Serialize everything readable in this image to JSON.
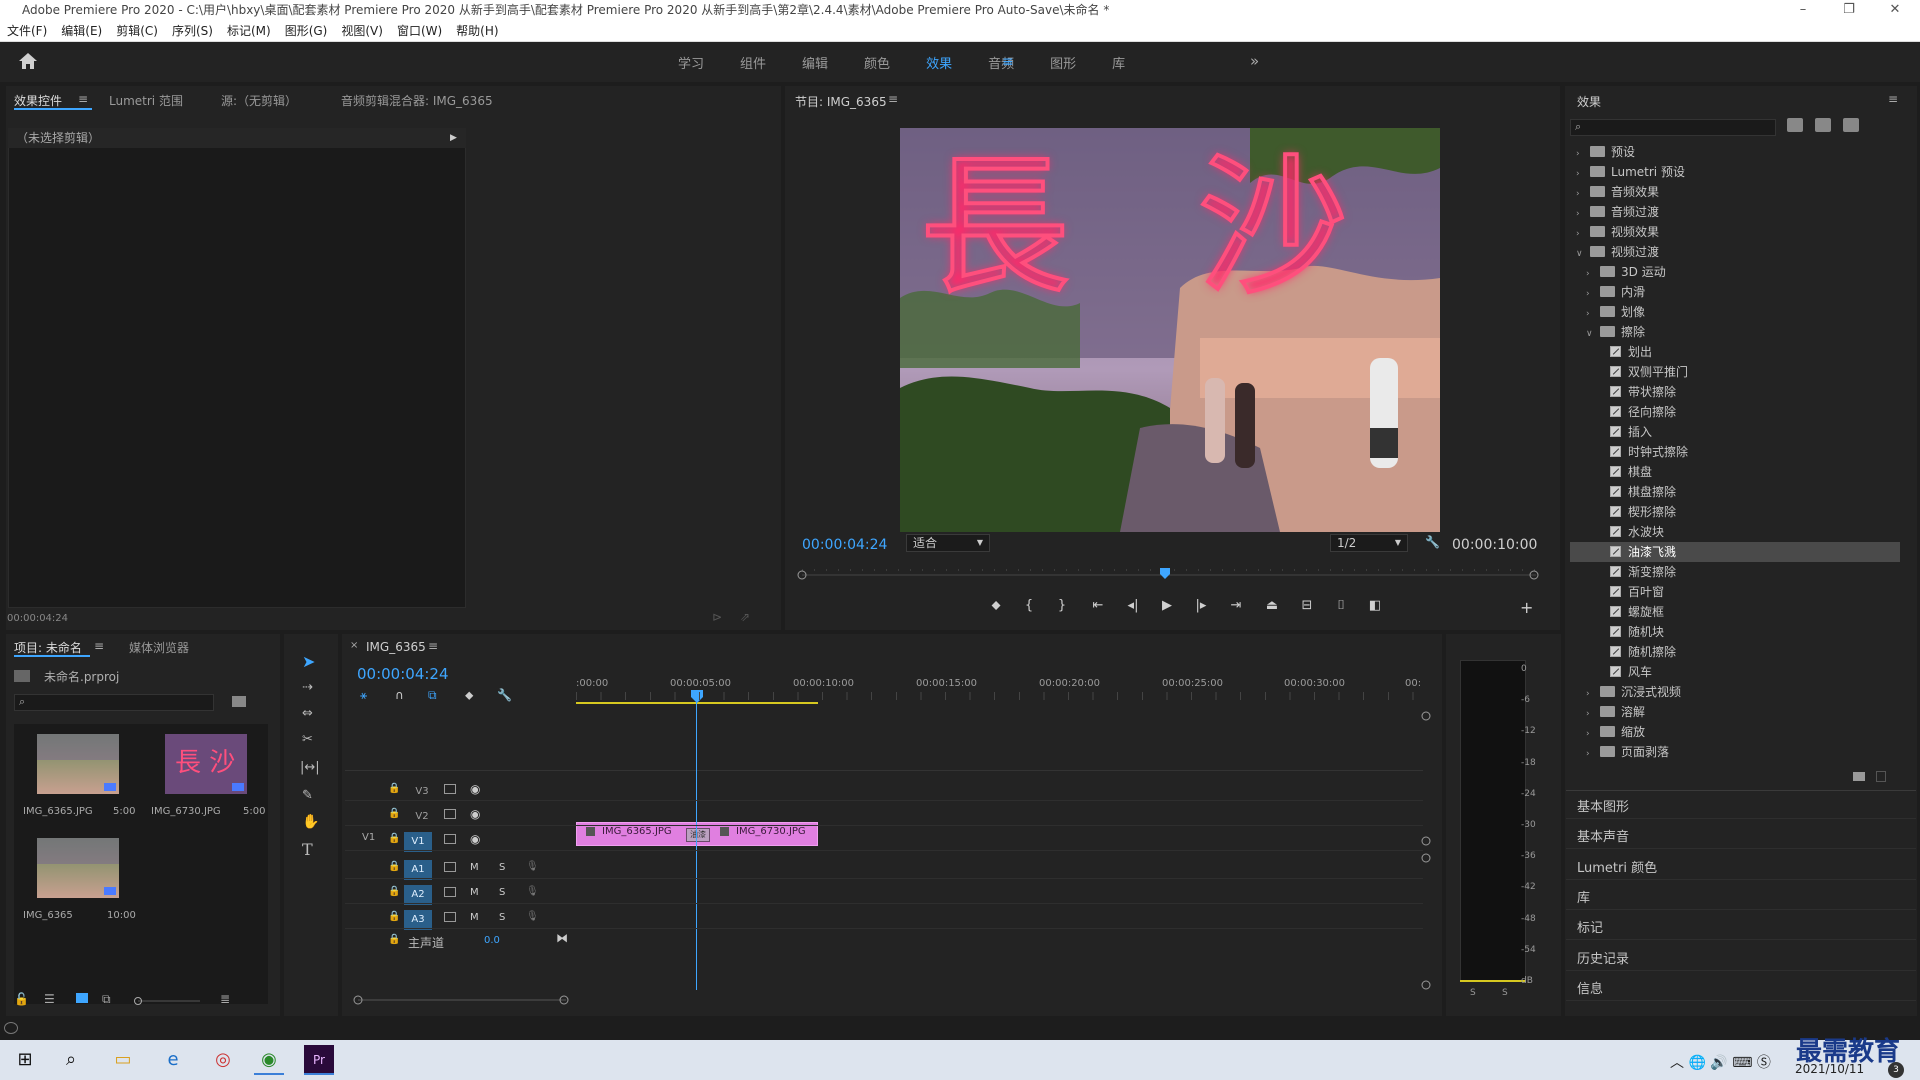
{
  "window": {
    "title": "Adobe Premiere Pro 2020 - C:\\用户\\hbxy\\桌面\\配套素材 Premiere Pro 2020 从新手到高手\\配套素材 Premiere Pro 2020 从新手到高手\\第2章\\2.4.4\\素材\\Adobe Premiere Pro Auto-Save\\未命名 *",
    "logo": "Pr"
  },
  "menu": [
    "文件(F)",
    "编辑(E)",
    "剪辑(C)",
    "序列(S)",
    "标记(M)",
    "图形(G)",
    "视图(V)",
    "窗口(W)",
    "帮助(H)"
  ],
  "workspaces": {
    "items": [
      "学习",
      "组件",
      "编辑",
      "颜色",
      "效果",
      "音频",
      "图形",
      "库"
    ],
    "active": "效果",
    "more": "»"
  },
  "source_panel": {
    "tabs": [
      "效果控件",
      "Lumetri 范围",
      "源:（无剪辑）",
      "音频剪辑混合器: IMG_6365"
    ],
    "no_clip": "（未选择剪辑）",
    "timecode": "00:00:04:24"
  },
  "program": {
    "title": "节目: IMG_6365",
    "timecode": "00:00:04:24",
    "fit": "适合",
    "res": "1/2",
    "duration": "00:00:10:00",
    "sign": "長 沙"
  },
  "project": {
    "tabs": [
      "项目: 未命名",
      "媒体浏览器"
    ],
    "file": "未命名.prproj",
    "items": [
      {
        "name": "IMG_6365.JPG",
        "dur": "5:00"
      },
      {
        "name": "IMG_6730.JPG",
        "dur": "5:00"
      },
      {
        "name": "IMG_6365",
        "dur": "10:00"
      }
    ]
  },
  "timeline": {
    "tab": "IMG_6365",
    "timecode": "00:00:04:24",
    "ruler": [
      ":00:00",
      "00:00:05:00",
      "00:00:10:00",
      "00:00:15:00",
      "00:00:20:00",
      "00:00:25:00",
      "00:00:30:00",
      "00:"
    ],
    "tracks": [
      "V3",
      "V2",
      "V1",
      "A1",
      "A2",
      "A3"
    ],
    "v1_label": "V1",
    "master": "主声道",
    "master_val": "0.0",
    "m": "M",
    "s": "S",
    "clips": [
      {
        "name": "IMG_6365.JPG"
      },
      {
        "name": "IMG_6730.JPG"
      }
    ],
    "transition": "油漆"
  },
  "meter": {
    "labels": [
      "0",
      "-6",
      "-12",
      "-18",
      "-24",
      "-30",
      "-36",
      "-42",
      "-48",
      "-54",
      "dB"
    ],
    "solo": [
      "S",
      "S"
    ]
  },
  "effects": {
    "title": "效果",
    "tree": [
      {
        "label": "预设",
        "lvl": 0,
        "type": "bin",
        "open": false
      },
      {
        "label": "Lumetri 预设",
        "lvl": 0,
        "type": "bin",
        "open": false
      },
      {
        "label": "音频效果",
        "lvl": 0,
        "type": "folder",
        "open": false
      },
      {
        "label": "音频过渡",
        "lvl": 0,
        "type": "folder",
        "open": false
      },
      {
        "label": "视频效果",
        "lvl": 0,
        "type": "folder",
        "open": false
      },
      {
        "label": "视频过渡",
        "lvl": 0,
        "type": "folder",
        "open": true
      },
      {
        "label": "3D 运动",
        "lvl": 1,
        "type": "folder",
        "open": false
      },
      {
        "label": "内滑",
        "lvl": 1,
        "type": "folder",
        "open": false
      },
      {
        "label": "划像",
        "lvl": 1,
        "type": "folder",
        "open": false
      },
      {
        "label": "擦除",
        "lvl": 1,
        "type": "folder",
        "open": true
      },
      {
        "label": "划出",
        "lvl": 2,
        "type": "fx"
      },
      {
        "label": "双侧平推门",
        "lvl": 2,
        "type": "fx"
      },
      {
        "label": "带状擦除",
        "lvl": 2,
        "type": "fx"
      },
      {
        "label": "径向擦除",
        "lvl": 2,
        "type": "fx"
      },
      {
        "label": "插入",
        "lvl": 2,
        "type": "fx"
      },
      {
        "label": "时钟式擦除",
        "lvl": 2,
        "type": "fx"
      },
      {
        "label": "棋盘",
        "lvl": 2,
        "type": "fx"
      },
      {
        "label": "棋盘擦除",
        "lvl": 2,
        "type": "fx"
      },
      {
        "label": "楔形擦除",
        "lvl": 2,
        "type": "fx"
      },
      {
        "label": "水波块",
        "lvl": 2,
        "type": "fx"
      },
      {
        "label": "油漆飞溅",
        "lvl": 2,
        "type": "fx",
        "sel": true
      },
      {
        "label": "渐变擦除",
        "lvl": 2,
        "type": "fx"
      },
      {
        "label": "百叶窗",
        "lvl": 2,
        "type": "fx"
      },
      {
        "label": "螺旋框",
        "lvl": 2,
        "type": "fx"
      },
      {
        "label": "随机块",
        "lvl": 2,
        "type": "fx"
      },
      {
        "label": "随机擦除",
        "lvl": 2,
        "type": "fx"
      },
      {
        "label": "风车",
        "lvl": 2,
        "type": "fx"
      },
      {
        "label": "沉浸式视频",
        "lvl": 1,
        "type": "folder",
        "open": false
      },
      {
        "label": "溶解",
        "lvl": 1,
        "type": "folder",
        "open": false
      },
      {
        "label": "缩放",
        "lvl": 1,
        "type": "folder",
        "open": false
      },
      {
        "label": "页面剥落",
        "lvl": 1,
        "type": "folder",
        "open": false
      }
    ],
    "sections": [
      "基本图形",
      "基本声音",
      "Lumetri 颜色",
      "库",
      "标记",
      "历史记录",
      "信息"
    ]
  },
  "taskbar": {
    "date": "2021/10/11",
    "time": "3",
    "watermark": "最需教育"
  },
  "colors": {
    "accent": "#3ea6ff",
    "clip": "#e07fe0",
    "playhead": "#3ea6ff"
  }
}
